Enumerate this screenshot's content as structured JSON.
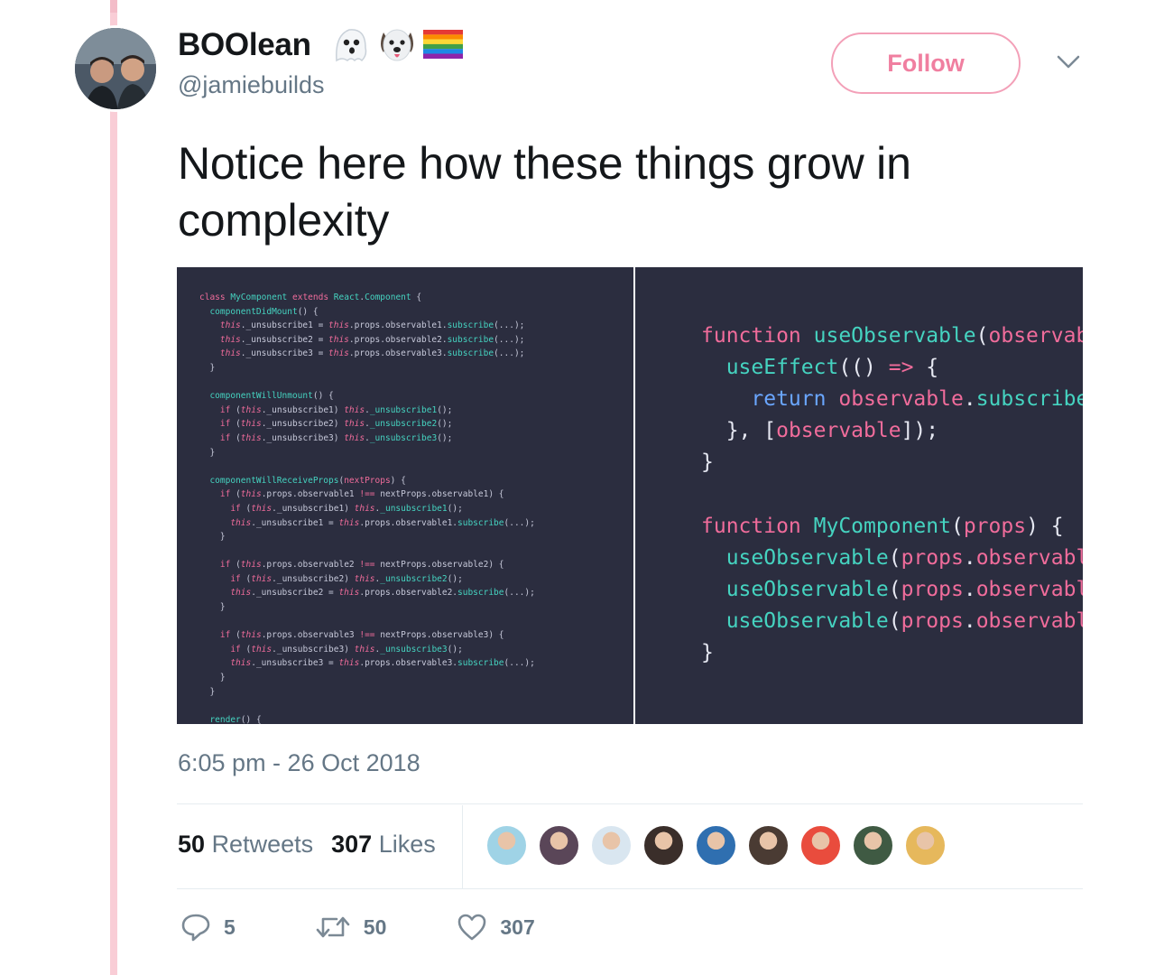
{
  "user": {
    "display_name": "BOOlean",
    "handle": "@jamiebuilds",
    "badges": [
      "ghost-icon",
      "dog-face-icon",
      "rainbow-flag-icon"
    ]
  },
  "follow_label": "Follow",
  "tweet_text": "Notice here how these things grow in complexity",
  "media": {
    "left_code_alt": "class MyComponent extends React.Component code",
    "right_code_alt": "useObservable hook code"
  },
  "timestamp": "6:05 pm - 26 Oct 2018",
  "stats": {
    "retweets_count": "50",
    "retweets_label": "Retweets",
    "likes_count": "307",
    "likes_label": "Likes"
  },
  "likers": [
    "#9fd3e6",
    "#5a4658",
    "#d9e6f0",
    "#3a2e2a",
    "#2f6fb0",
    "#4a3b33",
    "#e94c3d",
    "#3f5a43",
    "#e6b85c"
  ],
  "actions": {
    "reply_count": "5",
    "retweet_count": "50",
    "like_count": "307"
  },
  "colors": {
    "accent": "#f07fa0",
    "thread_line": "#f9cdd6",
    "code_bg": "#2b2d3f",
    "muted": "#657786"
  }
}
